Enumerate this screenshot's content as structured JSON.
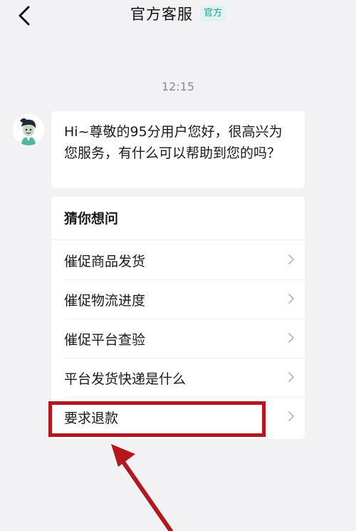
{
  "header": {
    "title": "官方客服",
    "badge": "官方",
    "back_icon": "chevron-left-icon"
  },
  "chat": {
    "timestamp": "12:15",
    "avatar_icon": "customer-service-avatar-icon",
    "message": "Hi~尊敬的95分用户您好，很高兴为您服务，有什么可以帮助到您的吗？"
  },
  "faq": {
    "title": "猜你想问",
    "item_icon": "chevron-right-icon",
    "items": [
      {
        "label": "催促商品发货"
      },
      {
        "label": "催促物流进度"
      },
      {
        "label": "催促平台查验"
      },
      {
        "label": "平台发货快递是什么"
      },
      {
        "label": "要求退款"
      }
    ]
  },
  "annotation": {
    "highlight_color": "#b3191c",
    "arrow_icon": "arrow-up-left-icon"
  },
  "colors": {
    "background": "#f2f2f5",
    "card": "#ffffff",
    "badge_text": "#12a29a",
    "badge_bg": "#dff3f1",
    "timestamp": "#8a8a8f"
  }
}
